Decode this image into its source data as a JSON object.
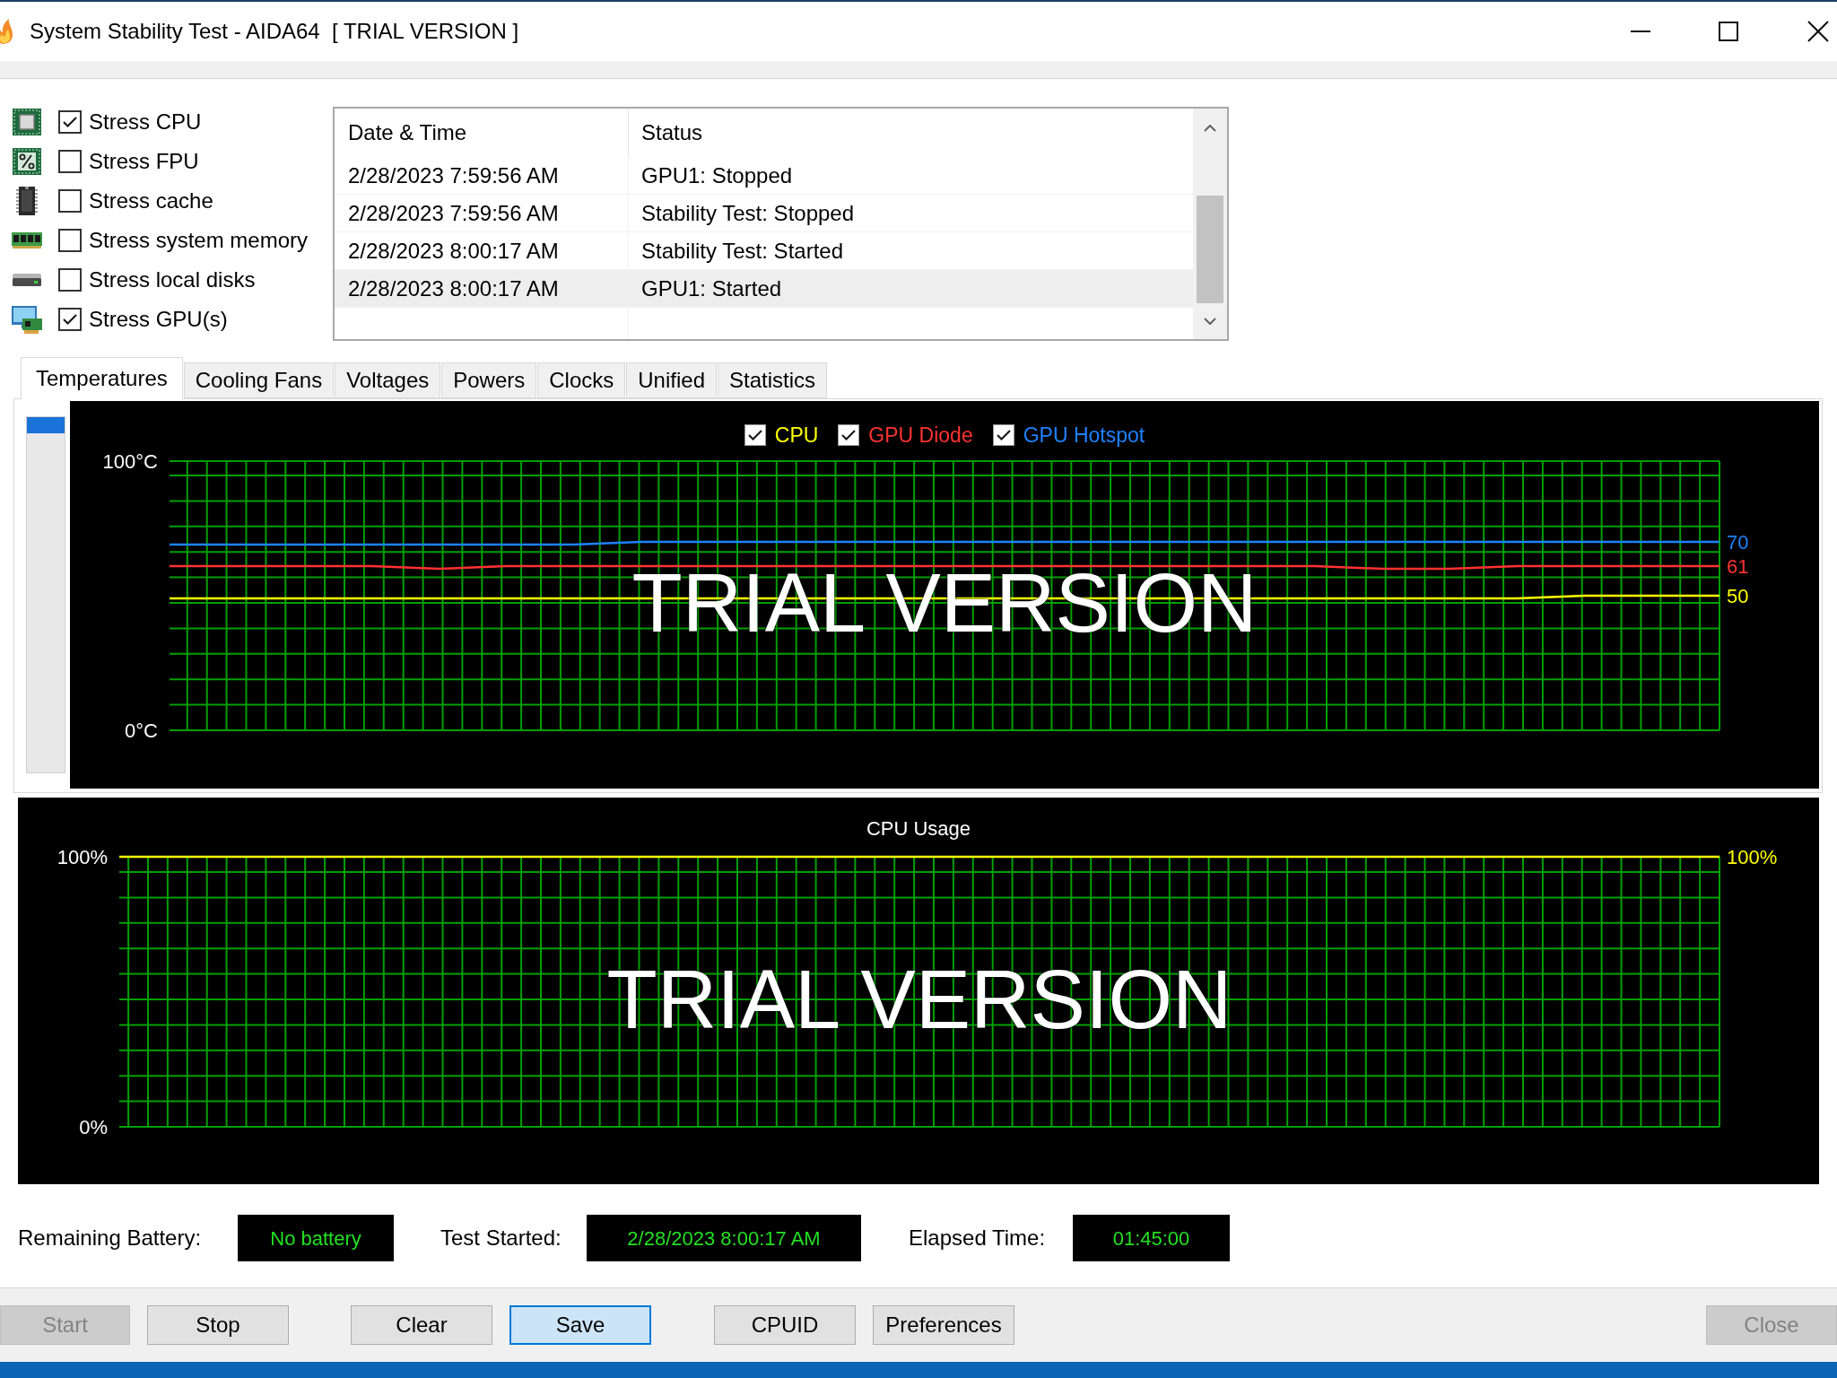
{
  "window": {
    "title": "System Stability Test - AIDA64  [ TRIAL VERSION ]"
  },
  "stress_options": [
    {
      "label": "Stress CPU",
      "checked": true
    },
    {
      "label": "Stress FPU",
      "checked": false
    },
    {
      "label": "Stress cache",
      "checked": false
    },
    {
      "label": "Stress system memory",
      "checked": false
    },
    {
      "label": "Stress local disks",
      "checked": false
    },
    {
      "label": "Stress GPU(s)",
      "checked": true
    }
  ],
  "event_log": {
    "columns": [
      "Date & Time",
      "Status"
    ],
    "rows": [
      {
        "cells": [
          "2/28/2023 7:59:56 AM",
          "GPU1: Stopped"
        ],
        "selected": false
      },
      {
        "cells": [
          "2/28/2023 7:59:56 AM",
          "Stability Test: Stopped"
        ],
        "selected": false
      },
      {
        "cells": [
          "2/28/2023 8:00:17 AM",
          "Stability Test: Started"
        ],
        "selected": false
      },
      {
        "cells": [
          "2/28/2023 8:00:17 AM",
          "GPU1: Started"
        ],
        "selected": true
      }
    ]
  },
  "tabs": [
    {
      "label": "Temperatures",
      "selected": true
    },
    {
      "label": "Cooling Fans",
      "selected": false
    },
    {
      "label": "Voltages",
      "selected": false
    },
    {
      "label": "Powers",
      "selected": false
    },
    {
      "label": "Clocks",
      "selected": false
    },
    {
      "label": "Unified",
      "selected": false
    },
    {
      "label": "Statistics",
      "selected": false
    }
  ],
  "temperature_chart": {
    "legend": [
      {
        "label": "CPU",
        "checked": true,
        "color": "#ffff00"
      },
      {
        "label": "GPU Diode",
        "checked": true,
        "color": "#ff3232"
      },
      {
        "label": "GPU Hotspot",
        "checked": true,
        "color": "#1e82ff"
      }
    ],
    "overlay_text": "TRIAL VERSION",
    "chart_data": {
      "type": "line",
      "ylim": [
        0,
        100
      ],
      "yticks": [
        {
          "value": 100,
          "label": "100°C"
        },
        {
          "value": 0,
          "label": "0°C"
        }
      ],
      "tick_labels": "y",
      "grid": true,
      "series": [
        {
          "color": "#1e82ff",
          "values": [
            69,
            69,
            69,
            69,
            69,
            69,
            69,
            70,
            70,
            70,
            70,
            70,
            70,
            70,
            70,
            70,
            70,
            70,
            70,
            70,
            70,
            70,
            70,
            70
          ]
        },
        {
          "color": "#ff3232",
          "values": [
            61,
            61,
            61,
            61,
            60,
            61,
            61,
            61,
            61,
            61,
            61,
            61,
            61,
            61,
            61,
            61,
            61,
            61,
            60,
            60,
            61,
            61,
            61,
            61
          ]
        },
        {
          "color": "#ffff00",
          "values": [
            49,
            49,
            49,
            49,
            49,
            49,
            49,
            49,
            49,
            49,
            49,
            49,
            49,
            49,
            49,
            49,
            49,
            49,
            49,
            49,
            49,
            50,
            50,
            50
          ]
        }
      ],
      "annotations": [
        "70",
        "61",
        "50"
      ]
    }
  },
  "cpu_usage_chart": {
    "overlay_text": "TRIAL VERSION",
    "chart_data": {
      "type": "line",
      "title": "CPU Usage",
      "ylim": [
        0,
        100
      ],
      "yticks": [
        {
          "value": 100,
          "label": "100%"
        },
        {
          "value": 0,
          "label": "0%"
        }
      ],
      "tick_labels": "y",
      "grid": true,
      "series": [
        {
          "color": "#ffff00",
          "values": [
            100,
            100,
            100,
            100,
            100,
            100,
            100,
            100,
            100,
            100,
            100,
            100,
            100,
            100,
            100,
            100,
            100,
            100,
            100,
            100,
            100,
            100,
            100,
            100
          ]
        }
      ],
      "annotations": [
        "100%"
      ]
    }
  },
  "status_fields": [
    {
      "label": "Remaining Battery:",
      "value": "No battery"
    },
    {
      "label": "Test Started:",
      "value": "2/28/2023 8:00:17 AM"
    },
    {
      "label": "Elapsed Time:",
      "value": "01:45:00"
    }
  ],
  "button_groups": [
    {
      "buttons": [
        {
          "label": "Start",
          "disabled": true,
          "focused": false
        },
        {
          "label": "Stop",
          "disabled": false,
          "focused": false
        }
      ]
    },
    {
      "buttons": [
        {
          "label": "Clear",
          "disabled": false,
          "focused": false
        },
        {
          "label": "Save",
          "disabled": false,
          "focused": true
        }
      ]
    },
    {
      "buttons": [
        {
          "label": "CPUID",
          "disabled": false,
          "focused": false
        },
        {
          "label": "Preferences",
          "disabled": false,
          "focused": false
        }
      ]
    },
    {
      "buttons": [
        {
          "label": "Close",
          "disabled": true,
          "focused": false
        }
      ]
    }
  ]
}
